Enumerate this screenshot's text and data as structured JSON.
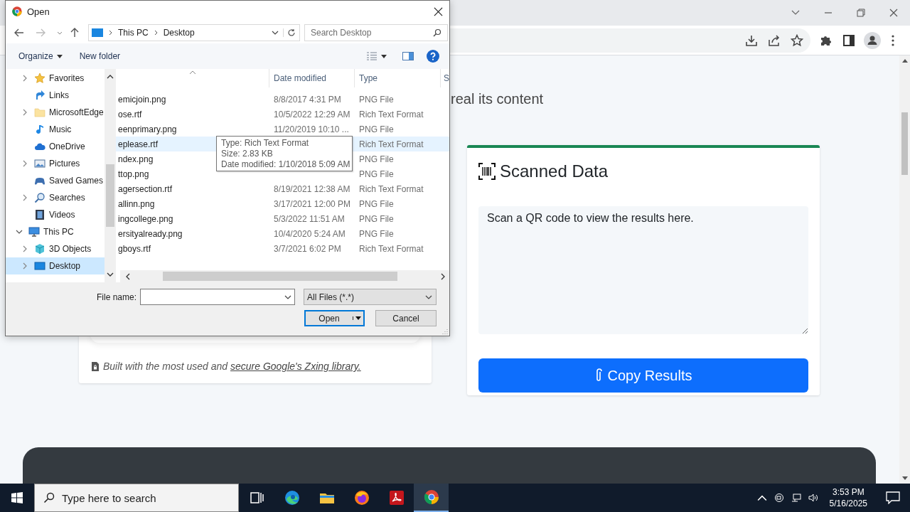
{
  "page": {
    "heading": "real its content",
    "footer_note": {
      "text": "Built with the most used and ",
      "link": "secure Google's Zxing library."
    },
    "scanned_card": {
      "title": "Scanned Data",
      "placeholder": "Scan a QR code to view the results here.",
      "button": "Copy Results"
    }
  },
  "dialog": {
    "title": "Open",
    "breadcrumb": [
      "This PC",
      "Desktop"
    ],
    "search_placeholder": "Search Desktop",
    "commands": {
      "organize": "Organize",
      "new_folder": "New folder"
    },
    "tree": [
      {
        "label": "Favorites",
        "kind": "favorites",
        "expanded": false,
        "selected": false
      },
      {
        "label": "Links",
        "kind": "links",
        "selected": false
      },
      {
        "label": "MicrosoftEdge",
        "kind": "folder",
        "expanded": false,
        "selected": false
      },
      {
        "label": "Music",
        "kind": "music",
        "selected": false
      },
      {
        "label": "OneDrive",
        "kind": "cloud",
        "selected": false
      },
      {
        "label": "Pictures",
        "kind": "pictures",
        "expanded": false,
        "selected": false
      },
      {
        "label": "Saved Games",
        "kind": "games",
        "selected": false
      },
      {
        "label": "Searches",
        "kind": "searches",
        "expanded": false,
        "selected": false
      },
      {
        "label": "Videos",
        "kind": "videos",
        "selected": false
      },
      {
        "label": "This PC",
        "kind": "computer",
        "expanded": true,
        "selected": false,
        "children": [
          {
            "label": "3D Objects",
            "kind": "objects",
            "expanded": false,
            "selected": false
          },
          {
            "label": "Desktop",
            "kind": "desktop",
            "expanded": false,
            "selected": true
          }
        ]
      }
    ],
    "columns": [
      "Date modified",
      "Type",
      "S"
    ],
    "files": [
      {
        "name": "emicjoin.png",
        "date": "8/8/2017 4:31 PM",
        "type": "PNG File",
        "selected": false
      },
      {
        "name": "ose.rtf",
        "date": "10/5/2022 12:29 AM",
        "type": "Rich Text Format",
        "selected": false
      },
      {
        "name": "eenprimary.png",
        "date": "11/20/2019 10:10 ...",
        "type": "PNG File",
        "selected": false
      },
      {
        "name": "eplease.rtf",
        "type": "Rich Text Format",
        "selected": true
      },
      {
        "name": "ndex.png",
        "type": "PNG File",
        "selected": false
      },
      {
        "name": "ttop.png",
        "type": "PNG File",
        "selected": false
      },
      {
        "name": "agersection.rtf",
        "date": "8/19/2021 12:38 AM",
        "type": "Rich Text Format",
        "selected": false
      },
      {
        "name": "allinn.png",
        "date": "3/17/2021 12:00 PM",
        "type": "PNG File",
        "selected": false
      },
      {
        "name": "ingcollege.png",
        "date": "5/3/2022 11:51 AM",
        "type": "PNG File",
        "selected": false
      },
      {
        "name": "ersityalready.png",
        "date": "10/4/2020 5:24 AM",
        "type": "PNG File",
        "selected": false
      },
      {
        "name": "gboys.rtf",
        "date": "3/7/2021 6:02 PM",
        "type": "Rich Text Format",
        "selected": false
      }
    ],
    "tooltip": [
      "Type: Rich Text Format",
      "Size: 2.83 KB",
      "Date modified: 1/10/2018 5:09 AM"
    ],
    "file_name_label": "File name:",
    "filter": "All Files (*.*)",
    "open_button": "Open",
    "cancel_button": "Cancel"
  },
  "taskbar": {
    "search_placeholder": "Type here to search",
    "apps": [
      {
        "kind": "task-view",
        "selected": false
      },
      {
        "kind": "edge",
        "selected": false
      },
      {
        "kind": "explorer",
        "selected": false
      },
      {
        "kind": "firefox",
        "selected": false
      },
      {
        "kind": "acrobat",
        "selected": false
      },
      {
        "kind": "chrome",
        "selected": true
      }
    ],
    "time": "3:53 PM",
    "date": "5/16/2025"
  }
}
